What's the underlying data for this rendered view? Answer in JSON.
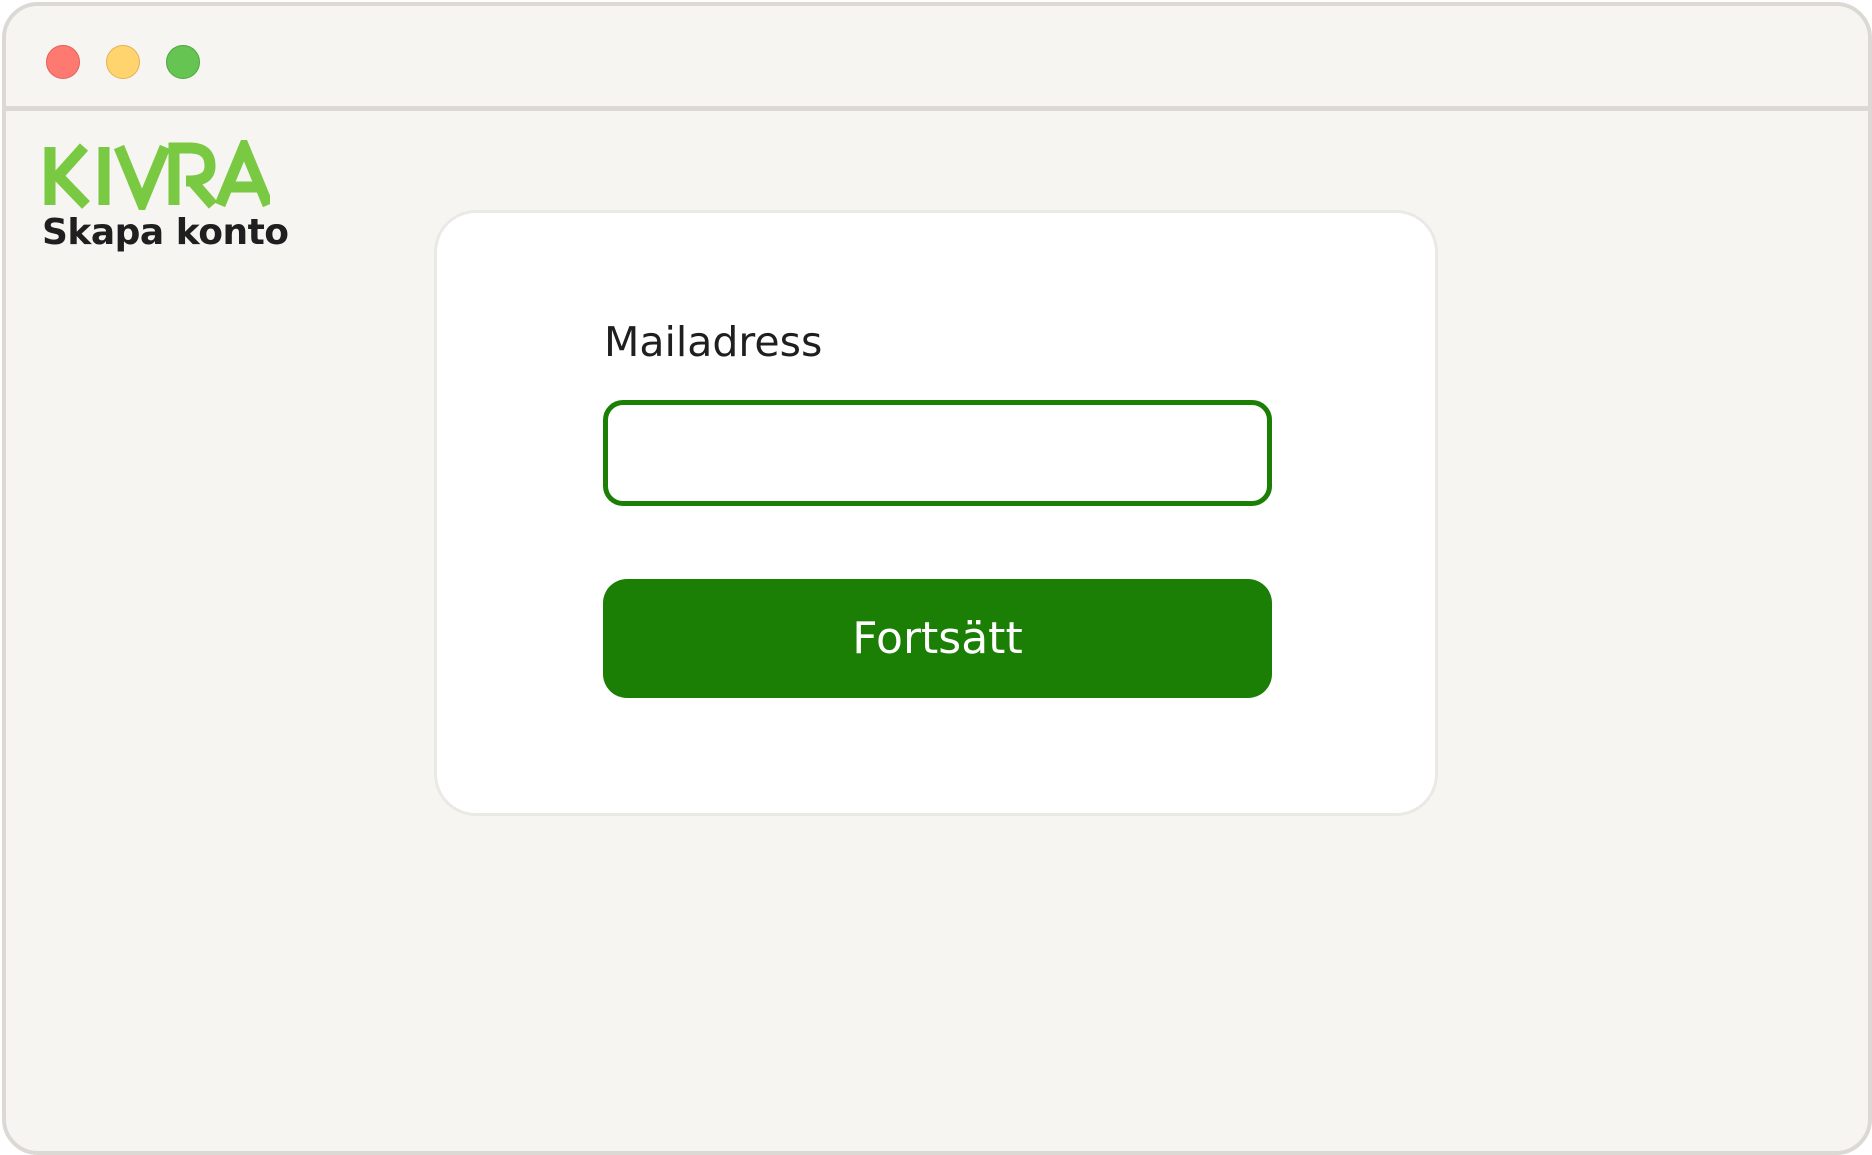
{
  "window": {
    "controls": {
      "close_color": "#fe7a70",
      "minimize_color": "#ffd36e",
      "zoom_color": "#66c452"
    }
  },
  "brand": {
    "logo_text": "KIVRA",
    "logo_color": "#7ac943"
  },
  "header": {
    "page_title": "Skapa konto"
  },
  "form": {
    "email_label": "Mailadress",
    "email_value": "",
    "continue_label": "Fortsätt",
    "accent_color": "#1a7f04"
  }
}
